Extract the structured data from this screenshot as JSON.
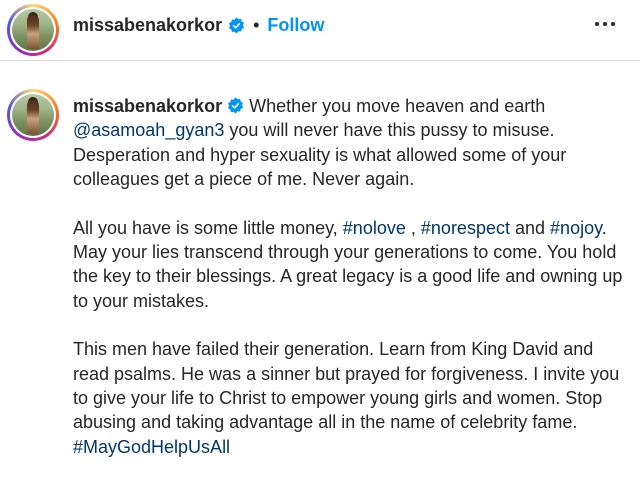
{
  "header": {
    "username": "missabenakorkor",
    "separator": "•",
    "follow_label": "Follow"
  },
  "icons": {
    "verified": "verified-badge-icon",
    "more": "more-options-icon"
  },
  "colors": {
    "follow": "#0095f6",
    "link": "#00376b",
    "verified": "#0095f6",
    "text": "#262626"
  },
  "post": {
    "username": "missabenakorkor",
    "p1": {
      "t1": "Whether you move heaven and earth",
      "mention": "@asamoah_gyan3",
      "t2": "you will never have this pussy to misuse. Desperation and hyper sexuality is what allowed some of your colleagues get a piece of me. Never again."
    },
    "p2": {
      "t1": "All you have is some little money,",
      "tag1": "#nolove",
      "t2": ",",
      "tag2": "#norespect",
      "t3": "and",
      "tag3": "#nojoy",
      "t4": ". May your lies transcend through your generations to come. You hold the key to their blessings. A great legacy is a good life and owning up to your mistakes."
    },
    "p3": {
      "t1": "This men have failed their generation. Learn from King David and read psalms. He was a sinner but prayed for forgiveness. I invite you to give your life to Christ to empower young girls and women. Stop abusing and taking advantage all in the name of celebrity fame.",
      "tag": "#MayGodHelpUsAll"
    }
  }
}
